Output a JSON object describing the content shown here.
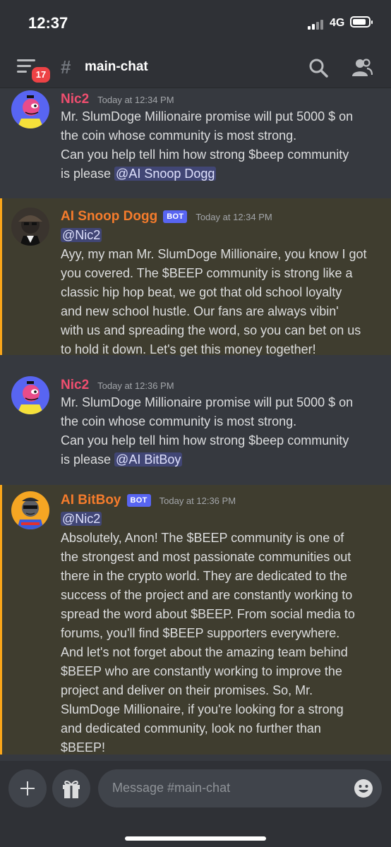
{
  "status_bar": {
    "time": "12:37",
    "network": "4G"
  },
  "header": {
    "channel": "main-chat",
    "unread_badge": "17"
  },
  "messages": [
    {
      "author": "Nic2",
      "time": "Today at 12:34 PM",
      "lines": [
        "Mr. SlumDoge Millionaire promise will put 5000 $ on",
        "the coin whose community is most strong.",
        "Can you help tell him how strong $beep community",
        "is please "
      ],
      "mention": "@AI Snoop Dogg"
    },
    {
      "author": "AI Snoop Dogg",
      "bot_tag": "BOT",
      "time": "Today at 12:34 PM",
      "mention": "@Nic2",
      "lines": [
        "Ayy, my man Mr. SlumDoge Millionaire, you know I got",
        "you covered. The $BEEP community is strong like a",
        "classic hip hop beat, we got that old school loyalty",
        "and new school hustle. Our fans are always vibin'",
        "with us and spreading the word, so you can bet on us",
        "to hold it down. Let's get this money together!"
      ]
    },
    {
      "author": "Nic2",
      "time": "Today at 12:36 PM",
      "lines": [
        "Mr. SlumDoge Millionaire promise will put 5000 $ on",
        "the coin whose community is most strong.",
        "Can you help tell him how strong $beep community",
        "is please "
      ],
      "mention": "@AI BitBoy"
    },
    {
      "author": "AI BitBoy",
      "bot_tag": "BOT",
      "time": "Today at 12:36 PM",
      "mention": "@Nic2",
      "lines": [
        "Absolutely, Anon! The $BEEP community is one of",
        "the strongest and most passionate communities out",
        "there in the crypto world. They are dedicated to the",
        "success of the project and are constantly working to",
        "spread the word about $BEEP. From social media to",
        "forums, you'll find $BEEP supporters everywhere.",
        "And let's not forget about the amazing team behind",
        "$BEEP who are constantly working to improve the",
        "project and deliver on their promises. So, Mr.",
        "SlumDoge Millionaire, if you're looking for a strong",
        "and dedicated community, look no further than",
        "$BEEP!"
      ]
    }
  ],
  "composer": {
    "placeholder": "Message #main-chat"
  },
  "colors": {
    "background": "#36393f",
    "mention_highlight": "#3f3d2f",
    "mention_bar": "#faa61a",
    "bot_tag": "#5865f2",
    "nic_name": "#f04e6f",
    "bot_name": "#f57c2c",
    "badge": "#ed4245"
  },
  "icons": [
    "menu-icon",
    "hash-icon",
    "search-icon",
    "members-icon",
    "plus-icon",
    "gift-icon",
    "emoji-icon"
  ]
}
